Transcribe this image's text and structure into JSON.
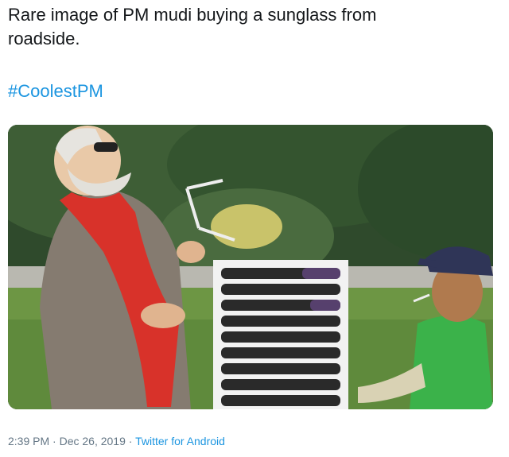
{
  "tweet": {
    "text_line1": "Rare image of PM mudi buying a sunglass from",
    "text_line2": "roadside.",
    "hashtag": "#CoolestPM"
  },
  "media": {
    "icon": "photo-icon"
  },
  "meta": {
    "time": "2:39 PM",
    "separator1": " · ",
    "date": "Dec 26, 2019",
    "separator2": " · ",
    "source": "Twitter for Android"
  },
  "colors": {
    "link": "#1b95e0",
    "text": "#14171a",
    "meta": "#657786"
  }
}
